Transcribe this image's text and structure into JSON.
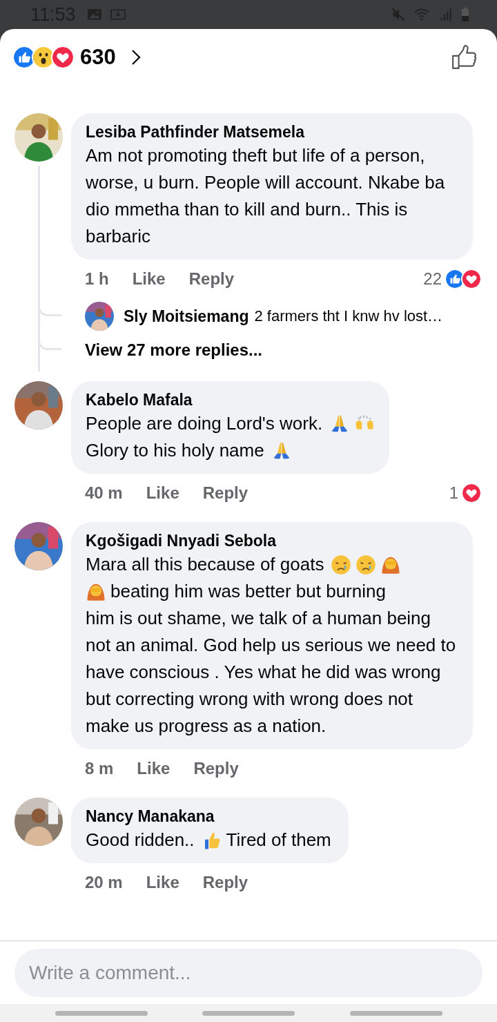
{
  "status_bar": {
    "time": "11:53"
  },
  "header": {
    "reaction_count": "630"
  },
  "comments": [
    {
      "name": "Lesiba Pathfinder Matsemela",
      "body": [
        [
          {
            "kind": "text",
            "text": "Am not promoting theft but life of a person, worse, u burn. People will account. Nkabe ba dio mmetha than to kill and burn.. This is barbaric"
          }
        ]
      ],
      "time": "1 h",
      "like": "Like",
      "reply": "Reply",
      "reactions": {
        "count": "22",
        "icons": [
          {
            "kind": "like"
          },
          {
            "kind": "love"
          }
        ]
      },
      "replies": {
        "items": [
          {
            "name": "Sly Moitsiemang",
            "text": "2 farmers tht I knw hv lost…"
          }
        ],
        "more": "View 27 more replies..."
      }
    },
    {
      "name": "Kabelo Mafala",
      "body": [
        [
          {
            "kind": "text",
            "text": "People are doing Lord's work."
          },
          {
            "kind": "pray"
          },
          {
            "kind": "raised-hands"
          }
        ],
        [
          {
            "kind": "text",
            "text": "Glory to his holy name"
          },
          {
            "kind": "pray"
          }
        ]
      ],
      "time": "40 m",
      "like": "Like",
      "reply": "Reply",
      "reactions": {
        "count": "1",
        "icons": [
          {
            "kind": "love"
          }
        ]
      }
    },
    {
      "name": "Kgošigadi Nnyadi Sebola",
      "body": [
        [
          {
            "kind": "text",
            "text": "Mara all this because of goats"
          },
          {
            "kind": "crying"
          },
          {
            "kind": "crying"
          },
          {
            "kind": "facepalm"
          }
        ],
        [
          {
            "kind": "facepalm"
          },
          {
            "kind": "text",
            "text": "beating him was better but burning"
          }
        ],
        [
          {
            "kind": "text",
            "text": "him is out shame, we talk of a human being not an animal. God help us serious we need to have conscious . Yes what he did was wrong but correcting wrong with wrong does not make us progress as a nation."
          }
        ]
      ],
      "time": "8 m",
      "like": "Like",
      "reply": "Reply"
    },
    {
      "name": "Nancy Manakana",
      "body": [
        [
          {
            "kind": "text",
            "text": "Good ridden.."
          },
          {
            "kind": "thumbs-up"
          },
          {
            "kind": "text",
            "text": "Tired of them"
          }
        ]
      ],
      "time": "20 m",
      "like": "Like",
      "reply": "Reply"
    }
  ],
  "composer": {
    "placeholder": "Write a comment..."
  }
}
